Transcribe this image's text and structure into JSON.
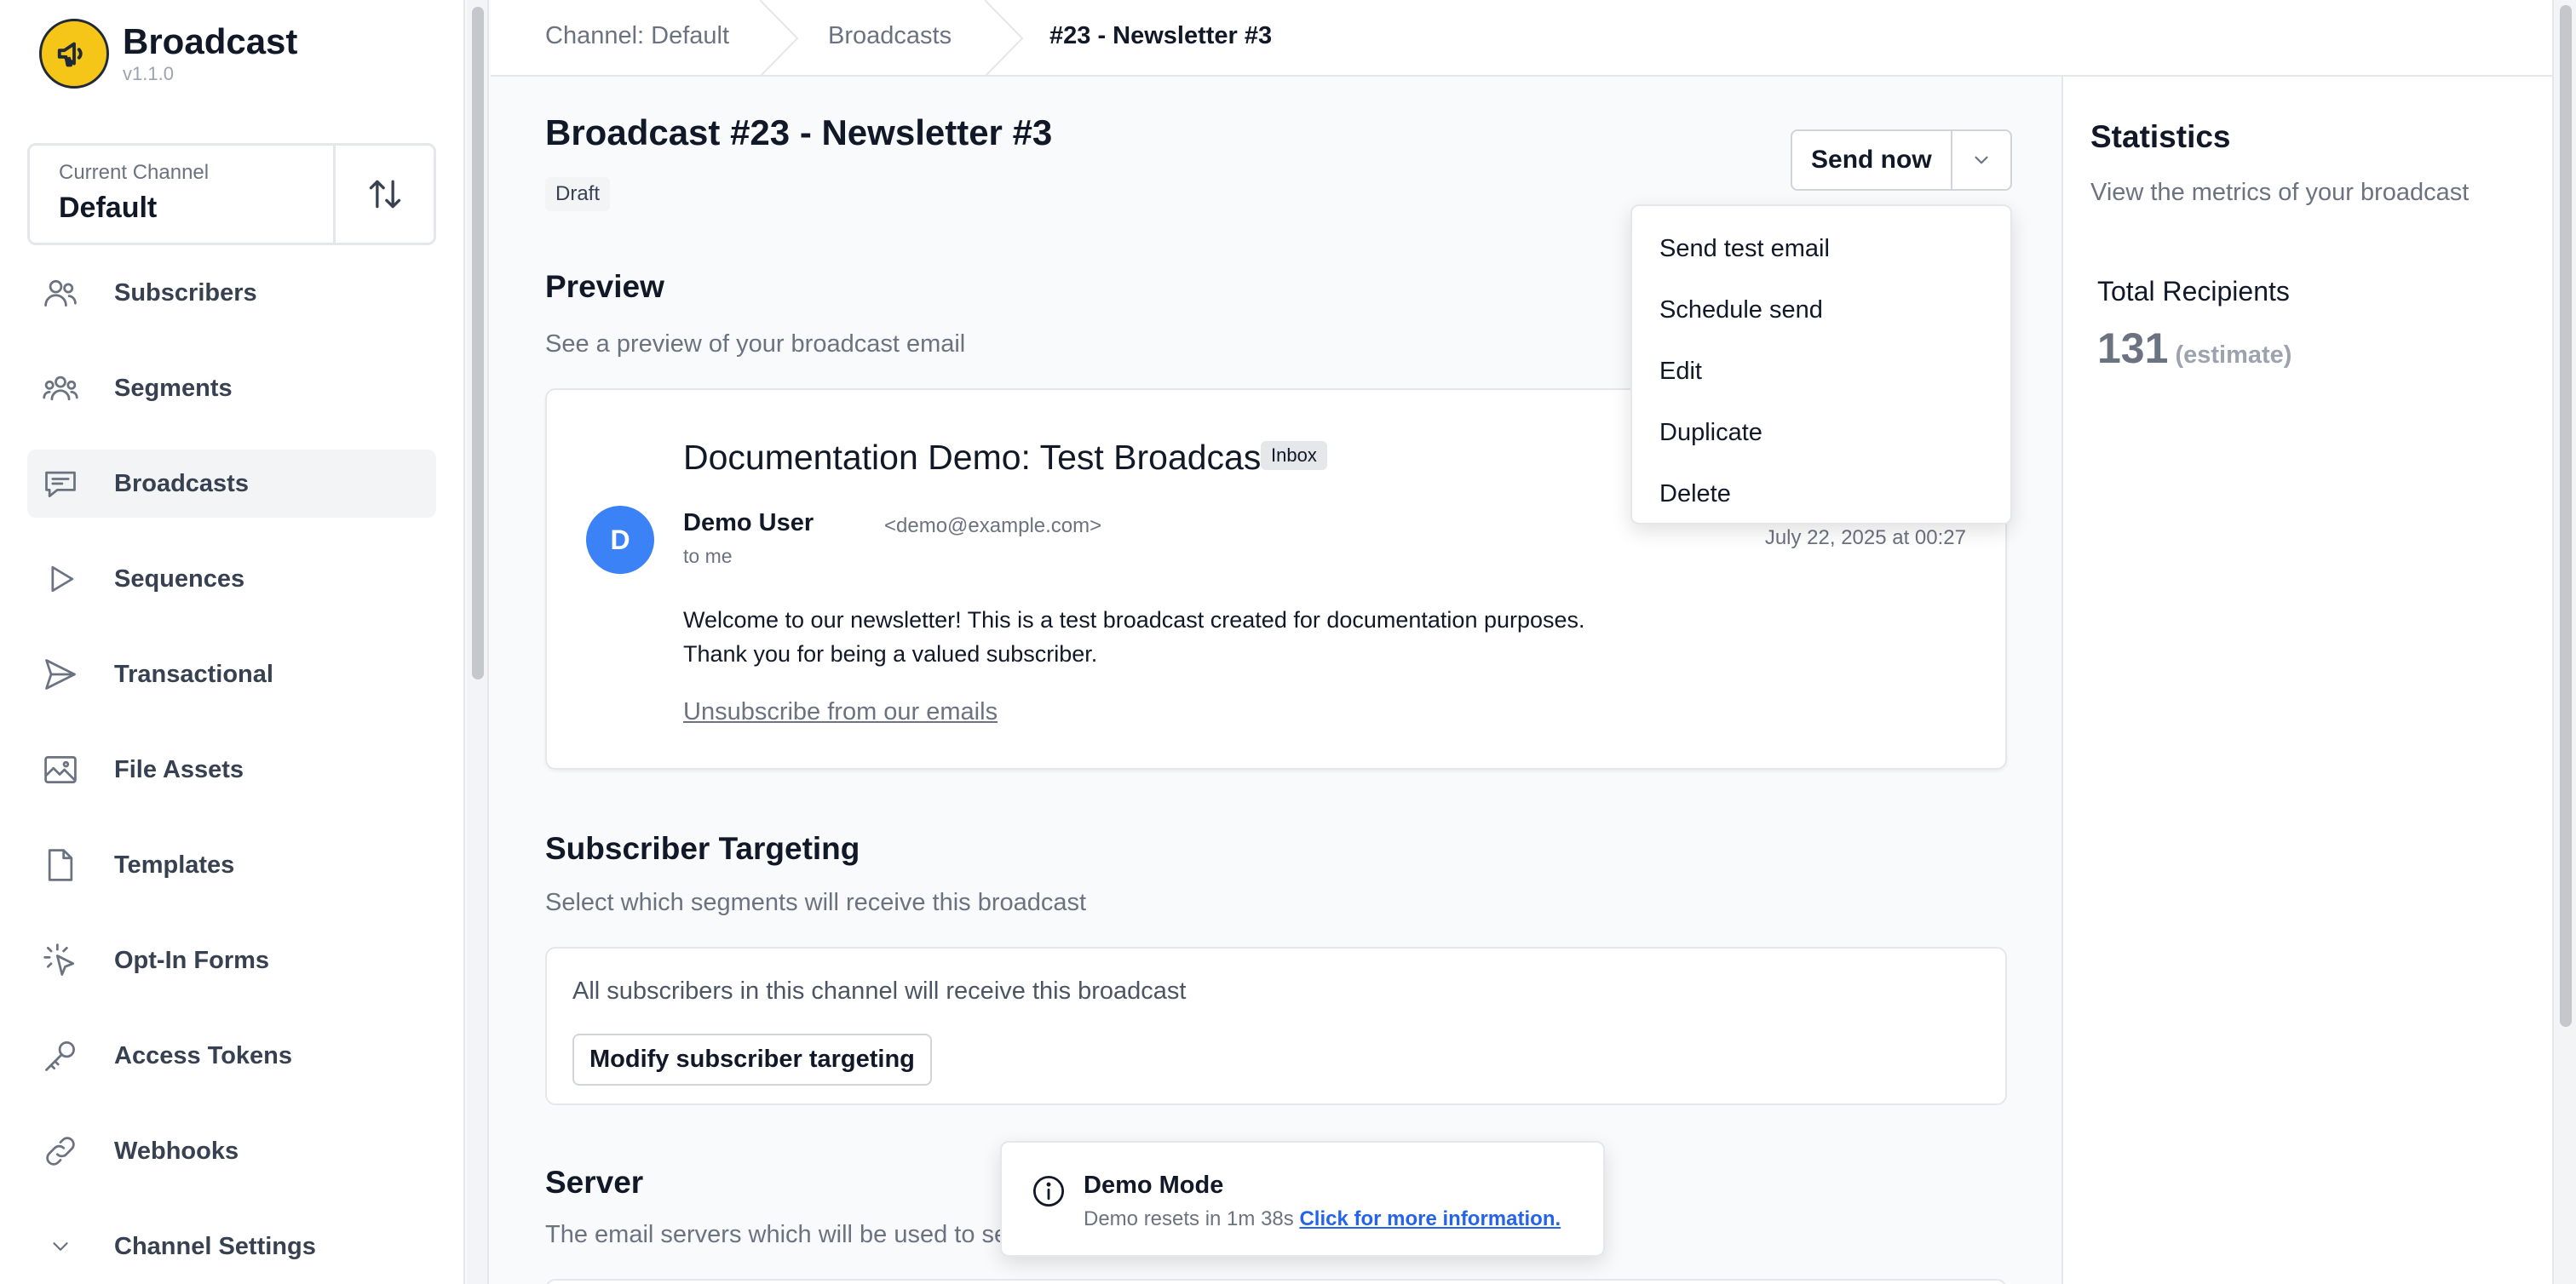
{
  "app": {
    "name": "Broadcast",
    "version": "v1.1.0",
    "brand_color": "#f5c518"
  },
  "channel": {
    "label": "Current Channel",
    "name": "Default"
  },
  "sidebar": {
    "items": [
      {
        "label": "Subscribers",
        "icon": "users-icon"
      },
      {
        "label": "Segments",
        "icon": "user-group-icon"
      },
      {
        "label": "Broadcasts",
        "icon": "chat-bubble-icon",
        "active": true
      },
      {
        "label": "Sequences",
        "icon": "play-icon"
      },
      {
        "label": "Transactional",
        "icon": "paper-plane-icon"
      },
      {
        "label": "File Assets",
        "icon": "image-icon"
      },
      {
        "label": "Templates",
        "icon": "document-icon"
      },
      {
        "label": "Opt-In Forms",
        "icon": "cursor-click-icon"
      },
      {
        "label": "Access Tokens",
        "icon": "key-icon"
      },
      {
        "label": "Webhooks",
        "icon": "link-icon"
      },
      {
        "label": "Channel Settings",
        "icon": "chevron-down-icon"
      }
    ]
  },
  "breadcrumb": [
    "Channel: Default",
    "Broadcasts",
    "#23 - Newsletter #3"
  ],
  "broadcast": {
    "title": "Broadcast #23 - Newsletter #3",
    "status": "Draft",
    "send_label": "Send now"
  },
  "dropdown": {
    "items": [
      "Send test email",
      "Schedule send",
      "Edit",
      "Duplicate",
      "Delete"
    ]
  },
  "preview": {
    "title": "Preview",
    "subtitle": "See a preview of your broadcast email",
    "subject": "Documentation Demo: Test Broadcast",
    "inbox_label": "Inbox",
    "avatar_letter": "D",
    "sender_name": "Demo User",
    "sender_email": "<demo@example.com>",
    "to": "to me",
    "date": "July 22, 2025 at 00:27",
    "body_line1": "Welcome to our newsletter! This is a test broadcast created for documentation purposes.",
    "body_line2": "Thank you for being a valued subscriber.",
    "unsubscribe": "Unsubscribe from our emails"
  },
  "targeting": {
    "title": "Subscriber Targeting",
    "subtitle": "Select which segments will receive this broadcast",
    "description": "All subscribers in this channel will receive this broadcast",
    "modify_label": "Modify subscriber targeting"
  },
  "server": {
    "title": "Server",
    "subtitle": "The email servers which will be used to se"
  },
  "statistics": {
    "title": "Statistics",
    "subtitle": "View the metrics of your broadcast",
    "total_label": "Total Recipients",
    "total_value": "131",
    "total_note": "(estimate)"
  },
  "toast": {
    "title": "Demo Mode",
    "body": "Demo resets in 1m 38s",
    "link": "Click for more information."
  }
}
